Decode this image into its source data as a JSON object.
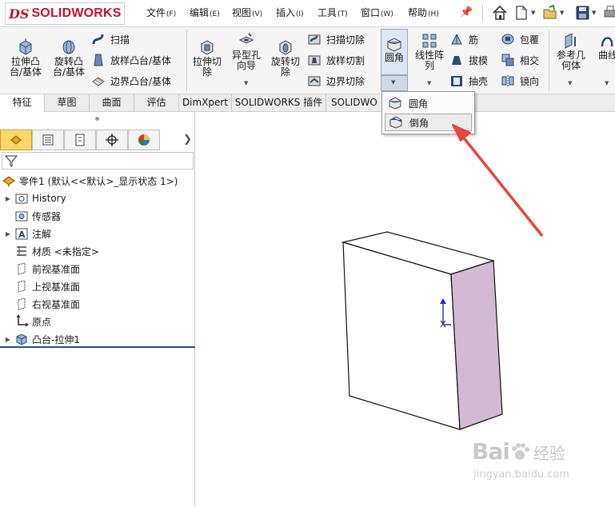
{
  "app": {
    "brand_prefix": "DS",
    "brand_name": "SOLIDWORKS"
  },
  "menu": [
    {
      "label": "文件",
      "hotkey": "(F)"
    },
    {
      "label": "编辑",
      "hotkey": "(E)"
    },
    {
      "label": "视图",
      "hotkey": "(V)"
    },
    {
      "label": "插入",
      "hotkey": "(I)"
    },
    {
      "label": "工具",
      "hotkey": "(T)"
    },
    {
      "label": "窗口",
      "hotkey": "(W)"
    },
    {
      "label": "帮助",
      "hotkey": "(H)"
    }
  ],
  "quick_access": [
    "home-icon",
    "new-document-icon",
    "open-icon",
    "save-icon",
    "print-icon"
  ],
  "ribbon": {
    "extrude_boss": [
      "拉伸凸",
      "台/基体"
    ],
    "revolve_boss": [
      "旋转凸",
      "台/基体"
    ],
    "sweep": "扫描",
    "loft_boss": "放样凸台/基体",
    "boundary_boss": "边界凸台/基体",
    "extrude_cut": [
      "拉伸切",
      "除"
    ],
    "hole_wizard": [
      "异型孔",
      "向导"
    ],
    "revolve_cut": [
      "旋转切",
      "除"
    ],
    "swept_cut": "扫描切除",
    "lofted_cut": "放样切割",
    "boundary_cut": "边界切除",
    "fillet": "圆角",
    "linear_pattern": [
      "线性阵",
      "列"
    ],
    "rib": "筋",
    "draft": "拔模",
    "shell": "抽壳",
    "wrap": "包覆",
    "intersect": "相交",
    "mirror": "镜向",
    "ref_geometry": [
      "参考几",
      "何体"
    ],
    "curves": "曲线"
  },
  "tabs": [
    "特征",
    "草图",
    "曲面",
    "评估",
    "DimXpert",
    "SOLIDWORKS 插件",
    "SOLIDWO"
  ],
  "active_tab": "特征",
  "fillet_dropdown": {
    "items": [
      "圆角",
      "倒角"
    ],
    "highlighted": "倒角"
  },
  "feature_tree": {
    "root": "零件1  (默认<<默认>_显示状态 1>)",
    "items": [
      {
        "label": "History",
        "expandable": true,
        "icon": "history-folder-icon"
      },
      {
        "label": "传感器",
        "expandable": false,
        "icon": "sensor-icon"
      },
      {
        "label": "注解",
        "expandable": true,
        "icon": "annotation-icon"
      },
      {
        "label": "材质 <未指定>",
        "expandable": false,
        "icon": "material-icon"
      },
      {
        "label": "前视基准面",
        "expandable": false,
        "icon": "plane-icon"
      },
      {
        "label": "上视基准面",
        "expandable": false,
        "icon": "plane-icon"
      },
      {
        "label": "右视基准面",
        "expandable": false,
        "icon": "plane-icon"
      },
      {
        "label": "原点",
        "expandable": false,
        "icon": "origin-icon"
      },
      {
        "label": "凸台-拉伸1",
        "expandable": true,
        "icon": "extrude-feature-icon"
      }
    ]
  },
  "watermark": {
    "brand": "Bai",
    "brand_suffix": "经验",
    "url": "jingyan.baidu.com"
  },
  "colors": {
    "selected_face": "#d2bbd2",
    "annotation_arrow": "#e8453c",
    "tab_active_bg": "#ffffff",
    "highlight": "#dde6f1"
  }
}
